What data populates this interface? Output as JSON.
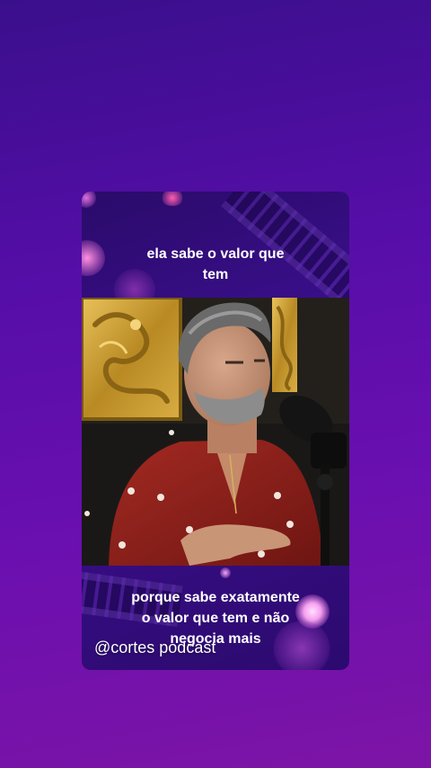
{
  "post": {
    "caption_top": "ela sabe o valor  que\ntem",
    "caption_bottom": "porque sabe exatamente\no valor que tem e não\nnegocia mais",
    "watermark": "@cortes podcast"
  },
  "colors": {
    "background_top": "#3a0f8c",
    "background_bottom": "#7d14a6",
    "caption_text": "#ffffff",
    "shirt": "#8b1f1a",
    "gold_panel": "#c79a2b"
  }
}
